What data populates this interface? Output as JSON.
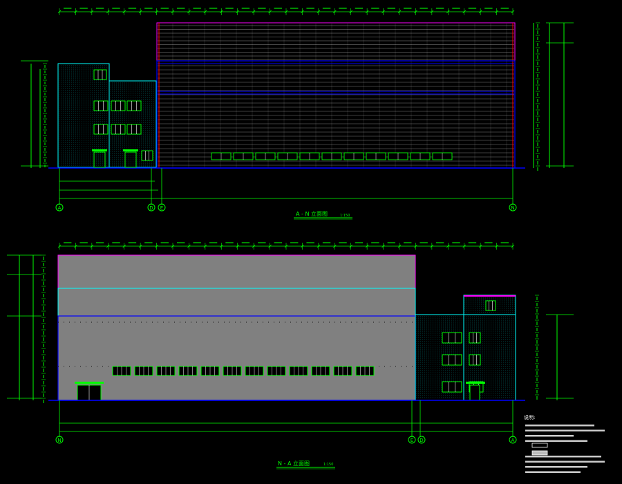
{
  "colors": {
    "background": "#000000",
    "dimension_green": "#00ff00",
    "grid_white": "#ffffff",
    "roof_magenta": "#ff00ff",
    "ground_blue": "#0000ff",
    "parapet_cyan": "#00ffff",
    "wall_gray": "#808080",
    "axis_red": "#ff0000"
  },
  "elevation_top": {
    "title": "A - N 立面图",
    "scale": "1:150",
    "axis_labels": [
      "A",
      "D",
      "E",
      "N"
    ]
  },
  "elevation_bottom": {
    "title": "N - A 立面图",
    "scale": "1:150",
    "axis_labels": [
      "N",
      "E",
      "D",
      "A"
    ]
  },
  "notes": {
    "heading": "说明:"
  }
}
